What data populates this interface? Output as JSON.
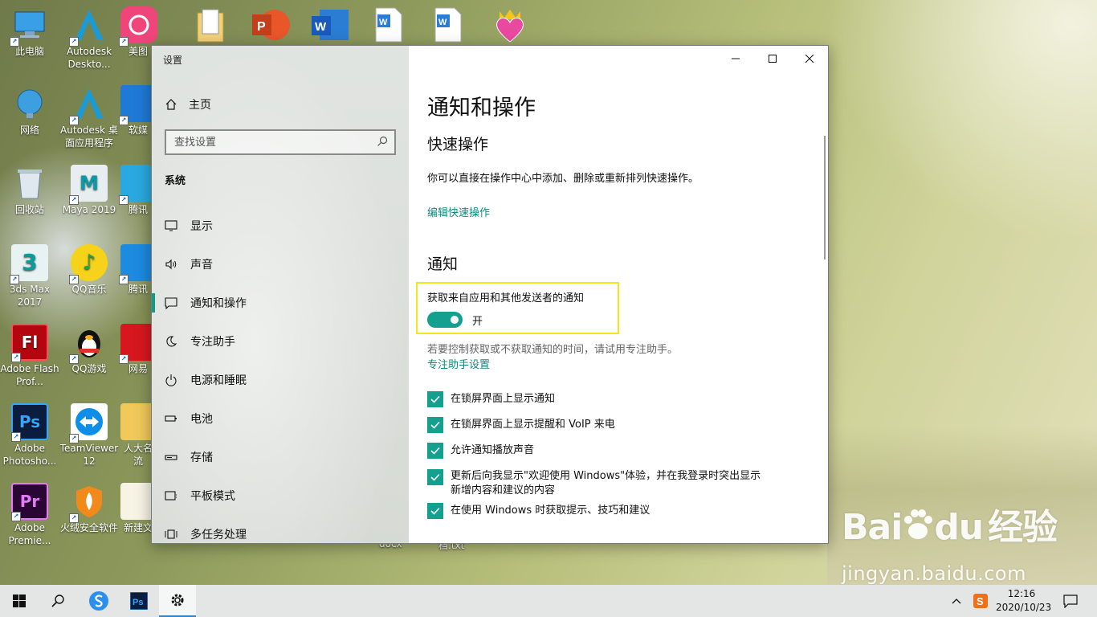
{
  "desktop": {
    "icons": [
      {
        "label": "此电脑"
      },
      {
        "label": "Autodesk Deskto..."
      },
      {
        "label": "美图"
      },
      {
        "label": "网络"
      },
      {
        "label": "Autodesk 桌面应用程序"
      },
      {
        "label": "软媒"
      },
      {
        "label": "回收站"
      },
      {
        "label": "Maya 2019"
      },
      {
        "label": "腾讯"
      },
      {
        "label": "3ds Max 2017"
      },
      {
        "label": "QQ音乐"
      },
      {
        "label": "腾讯"
      },
      {
        "label": "Adobe Flash Prof..."
      },
      {
        "label": "QQ游戏"
      },
      {
        "label": "网易"
      },
      {
        "label": "Adobe Photosho..."
      },
      {
        "label": "TeamViewer 12"
      },
      {
        "label": "人大名流"
      },
      {
        "label": "Adobe Premie..."
      },
      {
        "label": "火绒安全软件"
      },
      {
        "label": "新建文"
      },
      {
        "label": "docx"
      },
      {
        "label": "档.txt"
      }
    ]
  },
  "window": {
    "title": "设置",
    "sidebar": {
      "home_label": "主页",
      "search_placeholder": "查找设置",
      "section_label": "系统",
      "items": [
        {
          "label": "显示",
          "icon": "monitor-icon"
        },
        {
          "label": "声音",
          "icon": "speaker-icon"
        },
        {
          "label": "通知和操作",
          "icon": "notification-icon"
        },
        {
          "label": "专注助手",
          "icon": "moon-icon"
        },
        {
          "label": "电源和睡眠",
          "icon": "power-icon"
        },
        {
          "label": "电池",
          "icon": "battery-icon"
        },
        {
          "label": "存储",
          "icon": "storage-icon"
        },
        {
          "label": "平板模式",
          "icon": "tablet-icon"
        },
        {
          "label": "多任务处理",
          "icon": "multitask-icon"
        }
      ]
    },
    "main": {
      "page_title": "通知和操作",
      "quick_actions_heading": "快速操作",
      "quick_actions_desc": "你可以直接在操作中心中添加、删除或重新排列快速操作。",
      "edit_quick_actions_link": "编辑快速操作",
      "notifications_heading": "通知",
      "get_notifications_label": "获取来自应用和其他发送者的通知",
      "toggle_state": "开",
      "focus_hint": "若要控制获取或不获取通知的时间，请试用专注助手。",
      "focus_link": "专注助手设置",
      "checkboxes": [
        {
          "label": "在锁屏界面上显示通知",
          "checked": true
        },
        {
          "label": "在锁屏界面上显示提醒和 VoIP 来电",
          "checked": true
        },
        {
          "label": "允许通知播放声音",
          "checked": true
        },
        {
          "label": "更新后向我显示\"欢迎使用 Windows\"体验，并在我登录时突出显示",
          "label2": "新增内容和建议的内容",
          "checked": true
        },
        {
          "label": "在使用 Windows 时获取提示、技巧和建议",
          "checked": true
        }
      ]
    },
    "accent_color": "#14a08e",
    "highlight_color": "#f5e51b"
  },
  "taskbar": {
    "time": "12:16",
    "date": "2020/10/23"
  },
  "watermark": {
    "brand": "Bai",
    "brand2": "du",
    "brand3": "经验",
    "url": "jingyan.baidu.com"
  }
}
